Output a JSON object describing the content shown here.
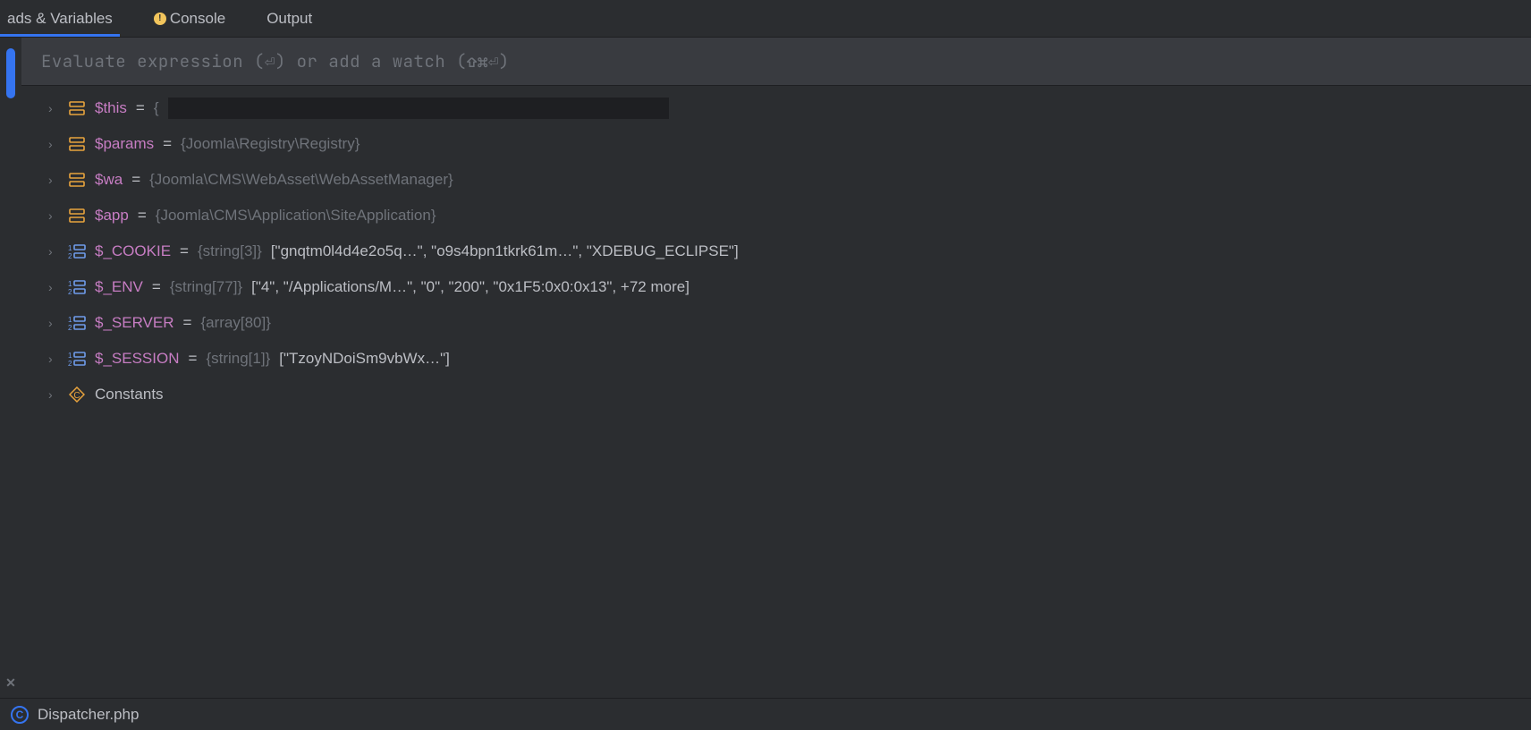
{
  "tabs": [
    {
      "label": "ads & Variables",
      "active": true
    },
    {
      "label": "Console",
      "active": false,
      "hasWarn": true
    },
    {
      "label": "Output",
      "active": false
    }
  ],
  "evalPlaceholder": "Evaluate expression (⏎) or add a watch (⇧⌘⏎)",
  "vars": [
    {
      "iconType": "obj",
      "name": "$this",
      "eq": "=",
      "type": "{",
      "value": "",
      "redact": true
    },
    {
      "iconType": "obj",
      "name": "$params",
      "eq": "=",
      "type": "{Joomla\\Registry\\Registry}",
      "value": ""
    },
    {
      "iconType": "obj",
      "name": "$wa",
      "eq": "=",
      "type": "{Joomla\\CMS\\WebAsset\\WebAssetManager}",
      "value": ""
    },
    {
      "iconType": "obj",
      "name": "$app",
      "eq": "=",
      "type": "{Joomla\\CMS\\Application\\SiteApplication}",
      "value": ""
    },
    {
      "iconType": "arr",
      "name": "$_COOKIE",
      "eq": "=",
      "type": "{string[3]}",
      "value": "[\"gnqtm0l4d4e2o5q…\", \"o9s4bpn1tkrk61m…\", \"XDEBUG_ECLIPSE\"]"
    },
    {
      "iconType": "arr",
      "name": "$_ENV",
      "eq": "=",
      "type": "{string[77]}",
      "value": "[\"4\", \"/Applications/M…\", \"0\", \"200\", \"0x1F5:0x0:0x13\", +72 more]"
    },
    {
      "iconType": "arr",
      "name": "$_SERVER",
      "eq": "=",
      "type": "{array[80]}",
      "value": ""
    },
    {
      "iconType": "arr",
      "name": "$_SESSION",
      "eq": "=",
      "type": "{string[1]}",
      "value": "[\"TzoyNDoiSm9vbWx…\"]"
    },
    {
      "iconType": "const",
      "name": "Constants",
      "eq": "",
      "type": "",
      "value": "",
      "plainName": true
    }
  ],
  "bottomFile": "Dispatcher.php"
}
